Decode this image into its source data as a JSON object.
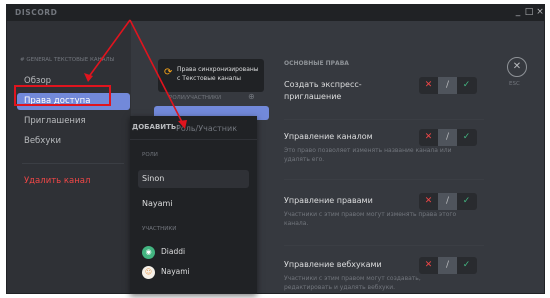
{
  "app": {
    "name": "DISCORD",
    "min_icon": "minimize-icon",
    "max_icon": "maximize-icon",
    "close_icon": "close-icon",
    "min_glyph": "_",
    "max_glyph": "□",
    "close_glyph": "×"
  },
  "sidebar": {
    "header": "# GENERAL ТЕКСТОВЫЕ КАНАЛЫ",
    "items": [
      {
        "label": "Обзор"
      },
      {
        "label": "Права доступа"
      },
      {
        "label": "Приглашения"
      },
      {
        "label": "Вебхуки"
      }
    ],
    "delete_label": "Удалить канал"
  },
  "middle": {
    "sync_text": "Права синхронизированы с Текстовые каналы",
    "sync_icon": "sync-icon",
    "roles_header": "РОЛИ/УЧАСТНИКИ",
    "add_icon": "plus-circle-icon"
  },
  "popup": {
    "add_label": "ДОБАВИТЬ:",
    "placeholder": "Роль/Участник",
    "roles_header": "РОЛИ",
    "roles": [
      {
        "label": "Sinon"
      },
      {
        "label": "Nayami"
      }
    ],
    "members_header": "УЧАСТНИКИ",
    "members": [
      {
        "label": "Diaddi",
        "avatar_icon": "discord-avatar-icon"
      },
      {
        "label": "Nayami",
        "avatar_icon": "character-avatar-icon"
      }
    ]
  },
  "permissions": {
    "title": "ОСНОВНЫЕ ПРАВА",
    "items": [
      {
        "name": "Создать экспресс-приглашение",
        "desc": ""
      },
      {
        "name": "Управление каналом",
        "desc": "Это право позволяет изменять название канала или удалять его."
      },
      {
        "name": "Управление правами",
        "desc": "Участники с этим правом могут изменять права этого канала."
      },
      {
        "name": "Управление вебхуками",
        "desc": "Участники с этим правом могут создавать, редактировать и удалять вебхуки."
      }
    ],
    "deny_glyph": "✕",
    "neutral_glyph": "/",
    "allow_glyph": "✓"
  },
  "esc": {
    "glyph": "✕",
    "label": "ESC",
    "icon": "close-circle-icon"
  },
  "annotation_colors": {
    "arrow": "#e0141e",
    "highlight": "#e0141e"
  }
}
